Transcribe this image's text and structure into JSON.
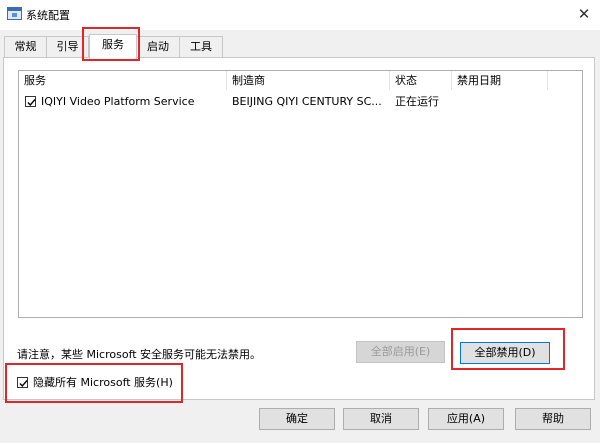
{
  "window": {
    "title": "系统配置",
    "close_glyph": "✕"
  },
  "tabs": [
    {
      "label": "常规"
    },
    {
      "label": "引导"
    },
    {
      "label": "服务"
    },
    {
      "label": "启动"
    },
    {
      "label": "工具"
    }
  ],
  "active_tab": "服务",
  "services_table": {
    "columns": [
      "服务",
      "制造商",
      "状态",
      "禁用日期"
    ],
    "rows": [
      {
        "checked": true,
        "service": "IQIYI Video Platform Service",
        "manufacturer": "BEIJING QIYI CENTURY SC...",
        "status": "正在运行",
        "disabled_date": ""
      }
    ]
  },
  "note": "请注意，某些 Microsoft 安全服务可能无法禁用。",
  "buttons": {
    "enable_all": "全部启用(E)",
    "disable_all": "全部禁用(D)",
    "ok": "确定",
    "cancel": "取消",
    "apply": "应用(A)",
    "help": "帮助"
  },
  "hide_microsoft": {
    "label": "隐藏所有 Microsoft 服务(H)",
    "checked": true
  },
  "colors": {
    "highlight_box": "#e1262a",
    "focus_border": "#0078d7"
  }
}
